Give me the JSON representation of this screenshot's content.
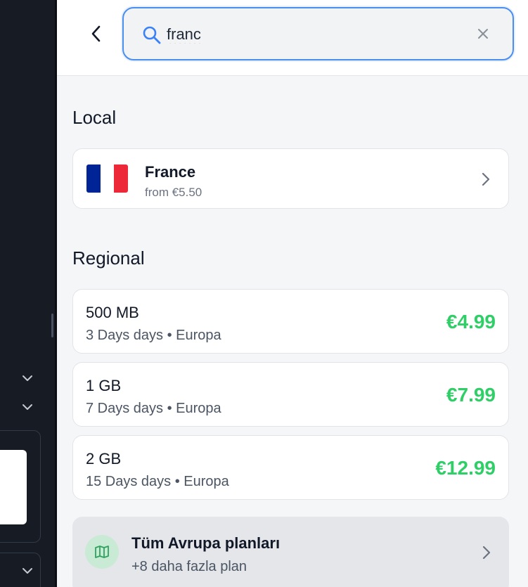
{
  "search": {
    "value": "franc",
    "placeholder": ""
  },
  "sections": {
    "local_title": "Local",
    "regional_title": "Regional"
  },
  "local": {
    "country": "France",
    "price_from": "from €5.50",
    "flag_colors": [
      "#002395",
      "#ffffff",
      "#ed2939"
    ]
  },
  "regional": {
    "plans": [
      {
        "data": "500 MB",
        "details": "3 Days days • Europa",
        "price": "€4.99"
      },
      {
        "data": "1 GB",
        "details": "7 Days days • Europa",
        "price": "€7.99"
      },
      {
        "data": "2 GB",
        "details": "15 Days days • Europa",
        "price": "€12.99"
      }
    ]
  },
  "all_plans": {
    "title": "Tüm Avrupa planları",
    "subtitle": "+8 daha fazla plan",
    "icon": "map-icon"
  },
  "colors": {
    "accent_blue": "#4a8ef0",
    "price_green": "#2fce67",
    "sidebar_dark": "#171b24"
  }
}
